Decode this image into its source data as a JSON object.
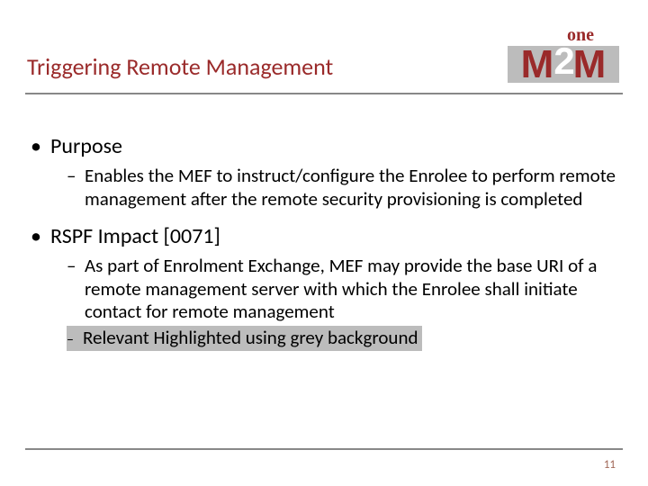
{
  "logo": {
    "text_one": "one",
    "text_m1": "M",
    "text_2": "2",
    "text_m2": "M"
  },
  "title": "Triggering Remote Management",
  "body": {
    "b1": "Purpose",
    "b1_1": "Enables the MEF to instruct/configure the Enrolee to perform remote management after the remote security provisioning is completed",
    "b2": "RSPF Impact [0071]",
    "b2_1": "As part of Enrolment Exchange, MEF may provide the base URI of a remote management server with which the Enrolee shall initiate contact for remote management",
    "b2_2": "Relevant Highlighted using grey background"
  },
  "page_number": "11"
}
